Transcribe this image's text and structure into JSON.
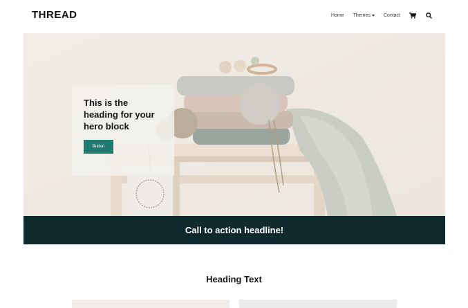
{
  "header": {
    "logo": "THREAD",
    "nav": [
      {
        "label": "Home"
      },
      {
        "label": "Themes"
      },
      {
        "label": "Contact"
      }
    ],
    "icons": [
      "cart-icon",
      "search-icon"
    ]
  },
  "hero": {
    "heading": "This is the heading for your hero block",
    "button_label": "Button",
    "image": "folded-knit-sweaters-on-stool"
  },
  "cta": {
    "headline": "Call to action headline!"
  },
  "section": {
    "heading": "Heading Text"
  },
  "colors": {
    "accent": "#1f7b72",
    "cta_bg": "#0f2a2c",
    "text": "#161616"
  }
}
